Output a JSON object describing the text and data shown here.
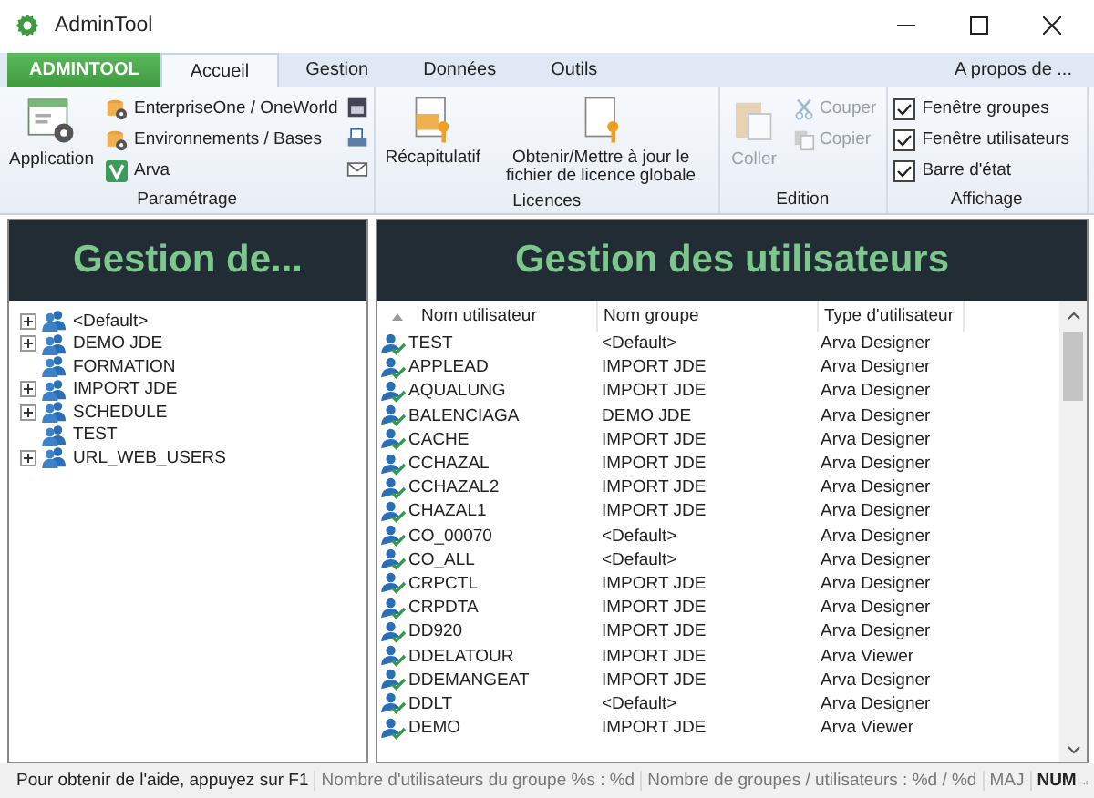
{
  "window": {
    "title": "AdminTool"
  },
  "app_button": "ADMINTOOL",
  "tabs": [
    {
      "label": "Accueil",
      "selected": true
    },
    {
      "label": "Gestion",
      "selected": false
    },
    {
      "label": "Données",
      "selected": false
    },
    {
      "label": "Outils",
      "selected": false
    }
  ],
  "about": "A propos de ...",
  "ribbon": {
    "parametrage": {
      "label": "Paramétrage",
      "big": "Application",
      "items": [
        "EnterpriseOne / OneWorld",
        "Environnements / Bases",
        "Arva"
      ]
    },
    "licences": {
      "label": "Licences",
      "buttons": [
        "Récapitulatif",
        "Obtenir/Mettre à jour le fichier de licence globale"
      ]
    },
    "edition": {
      "label": "Edition",
      "paste": {
        "label": "Coller",
        "disabled": true
      },
      "items": [
        {
          "label": "Couper",
          "disabled": true
        },
        {
          "label": "Copier",
          "disabled": true
        }
      ]
    },
    "affichage": {
      "label": "Affichage",
      "options": [
        {
          "label": "Fenêtre groupes",
          "checked": true
        },
        {
          "label": "Fenêtre utilisateurs",
          "checked": true
        },
        {
          "label": "Barre d'état",
          "checked": true
        }
      ]
    }
  },
  "groups_panel": {
    "title": "Gestion de...",
    "tree": [
      {
        "label": "<Default>",
        "expandable": true
      },
      {
        "label": "DEMO JDE",
        "expandable": true
      },
      {
        "label": "FORMATION",
        "expandable": false
      },
      {
        "label": "IMPORT JDE",
        "expandable": true
      },
      {
        "label": "SCHEDULE",
        "expandable": true
      },
      {
        "label": "TEST",
        "expandable": false
      },
      {
        "label": "URL_WEB_USERS",
        "expandable": true
      }
    ]
  },
  "users_panel": {
    "title": "Gestion des utilisateurs",
    "columns": [
      "Nom utilisateur",
      "Nom groupe",
      "Type d'utilisateur"
    ],
    "rows": [
      [
        "TEST",
        "<Default>",
        "Arva Designer"
      ],
      [
        "APPLEAD",
        "IMPORT JDE",
        "Arva Designer"
      ],
      [
        "AQUALUNG",
        "IMPORT JDE",
        "Arva Designer"
      ],
      [
        "BALENCIAGA",
        "DEMO JDE",
        "Arva Designer"
      ],
      [
        "CACHE",
        "IMPORT JDE",
        "Arva Designer"
      ],
      [
        "CCHAZAL",
        "IMPORT JDE",
        "Arva Designer"
      ],
      [
        "CCHAZAL2",
        "IMPORT JDE",
        "Arva Designer"
      ],
      [
        "CHAZAL1",
        "IMPORT JDE",
        "Arva Designer"
      ],
      [
        "CO_00070",
        "<Default>",
        "Arva Designer"
      ],
      [
        "CO_ALL",
        "<Default>",
        "Arva Designer"
      ],
      [
        "CRPCTL",
        "IMPORT JDE",
        "Arva Designer"
      ],
      [
        "CRPDTA",
        "IMPORT JDE",
        "Arva Designer"
      ],
      [
        "DD920",
        "IMPORT JDE",
        "Arva Designer"
      ],
      [
        "DDELATOUR",
        "IMPORT JDE",
        "Arva Viewer"
      ],
      [
        "DDEMANGEAT",
        "IMPORT JDE",
        "Arva Designer"
      ],
      [
        "DDLT",
        "<Default>",
        "Arva Designer"
      ],
      [
        "DEMO",
        "IMPORT JDE",
        "Arva Viewer"
      ]
    ]
  },
  "status_bar": [
    {
      "text": "Pour obtenir de l'aide, appuyez sur F1",
      "on": true
    },
    {
      "text": "Nombre d'utilisateurs du groupe %s : %d",
      "on": false
    },
    {
      "text": "Nombre de groupes / utilisateurs : %d / %d",
      "on": false
    },
    {
      "text": "MAJ",
      "on": false
    },
    {
      "text": "NUM",
      "on": true
    }
  ]
}
